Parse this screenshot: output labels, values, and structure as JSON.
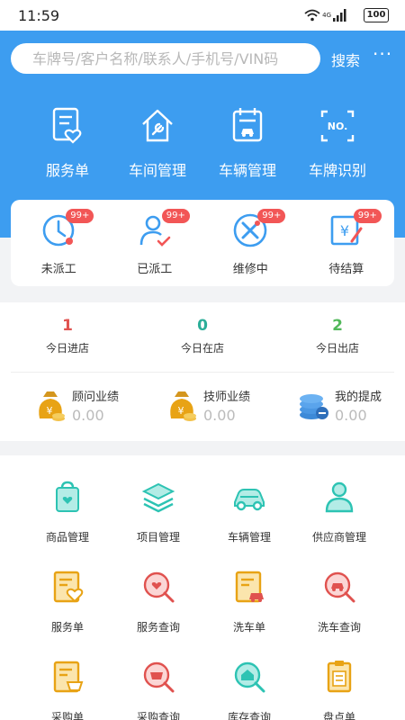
{
  "status_bar": {
    "time": "11:59",
    "network": "4G",
    "battery": "100"
  },
  "search": {
    "placeholder": "车牌号/客户名称/联系人/手机号/VIN码",
    "button": "搜索",
    "more": "···"
  },
  "top_nav": [
    {
      "label": "服务单",
      "icon": "service-order-icon"
    },
    {
      "label": "车间管理",
      "icon": "workshop-icon"
    },
    {
      "label": "车辆管理",
      "icon": "vehicle-calendar-icon"
    },
    {
      "label": "车牌识别",
      "icon": "plate-scan-icon"
    }
  ],
  "status_items": [
    {
      "label": "未派工",
      "badge": "99+",
      "icon": "clock-icon"
    },
    {
      "label": "已派工",
      "badge": "99+",
      "icon": "user-check-icon"
    },
    {
      "label": "维修中",
      "badge": "99+",
      "icon": "repair-tools-icon"
    },
    {
      "label": "待结算",
      "badge": "99+",
      "icon": "settlement-icon"
    }
  ],
  "daily_stats": [
    {
      "value": "1",
      "label": "今日进店",
      "color": "#e0524f"
    },
    {
      "value": "0",
      "label": "今日在店",
      "color": "#2bae98"
    },
    {
      "value": "2",
      "label": "今日出店",
      "color": "#52b85b"
    }
  ],
  "performance": [
    {
      "label": "顾问业绩",
      "value": "0.00",
      "icon": "money-bag-icon"
    },
    {
      "label": "技师业绩",
      "value": "0.00",
      "icon": "money-bag-icon"
    },
    {
      "label": "我的提成",
      "value": "0.00",
      "icon": "coin-stack-icon"
    }
  ],
  "grid": [
    {
      "label": "商品管理",
      "icon": "product-bag-icon",
      "color": "#2dc3b3"
    },
    {
      "label": "项目管理",
      "icon": "project-layers-icon",
      "color": "#2dc3b3"
    },
    {
      "label": "车辆管理",
      "icon": "car-icon",
      "color": "#2dc3b3"
    },
    {
      "label": "供应商管理",
      "icon": "supplier-icon",
      "color": "#2dc3b3"
    },
    {
      "label": "服务单",
      "icon": "service-doc-icon",
      "color": "#e8a315"
    },
    {
      "label": "服务查询",
      "icon": "service-search-icon",
      "color": "#e0524f"
    },
    {
      "label": "洗车单",
      "icon": "wash-doc-icon",
      "color": "#e8a315"
    },
    {
      "label": "洗车查询",
      "icon": "wash-search-icon",
      "color": "#e0524f"
    },
    {
      "label": "采购单",
      "icon": "purchase-doc-icon",
      "color": "#e8a315"
    },
    {
      "label": "采购查询",
      "icon": "purchase-search-icon",
      "color": "#e0524f"
    },
    {
      "label": "库存查询",
      "icon": "inventory-search-icon",
      "color": "#2dc3b3"
    },
    {
      "label": "盘点单",
      "icon": "stocktake-icon",
      "color": "#e8a315"
    }
  ]
}
